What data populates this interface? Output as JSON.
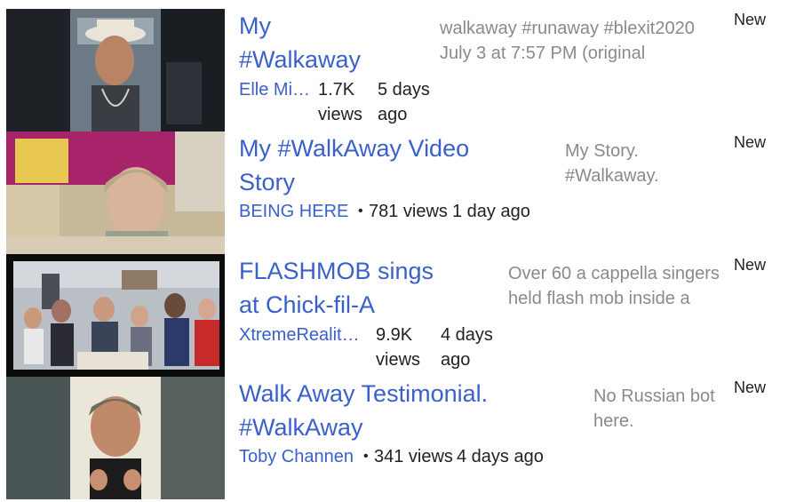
{
  "videos": [
    {
      "title_line1": "My",
      "title_line2": "#Walkaway",
      "channel": "Elle Mi…",
      "views_line1": "1.7K",
      "views_line2": "views",
      "age_line1": "5 days",
      "age_line2": "ago",
      "description_line1": "walkaway #runaway #blexit2020",
      "description_line2": "July 3 at 7:57 PM (original",
      "badge": "New"
    },
    {
      "title_line1": "My #WalkAway Video",
      "title_line2": "Story",
      "channel": "BEING HERE",
      "separator": "•",
      "views": "781 views",
      "age": "1 day ago",
      "description_line1": "My Story.",
      "description_line2": "#Walkaway.",
      "badge": "New"
    },
    {
      "title_line1": "FLASHMOB sings",
      "title_line2": "at Chick-fil-A",
      "channel": "XtremeRealit…",
      "views_line1": "9.9K",
      "views_line2": "views",
      "age_line1": "4 days",
      "age_line2": "ago",
      "description_line1": "Over 60 a cappella singers",
      "description_line2": "held flash mob inside a",
      "badge": "New"
    },
    {
      "title_line1": "Walk Away Testimonial.",
      "title_line2": "#WalkAway",
      "channel": "Toby Channen",
      "separator": "•",
      "views": "341 views",
      "age": "4 days ago",
      "description_line1": "No Russian bot",
      "description_line2": "here.",
      "badge": "New"
    }
  ]
}
